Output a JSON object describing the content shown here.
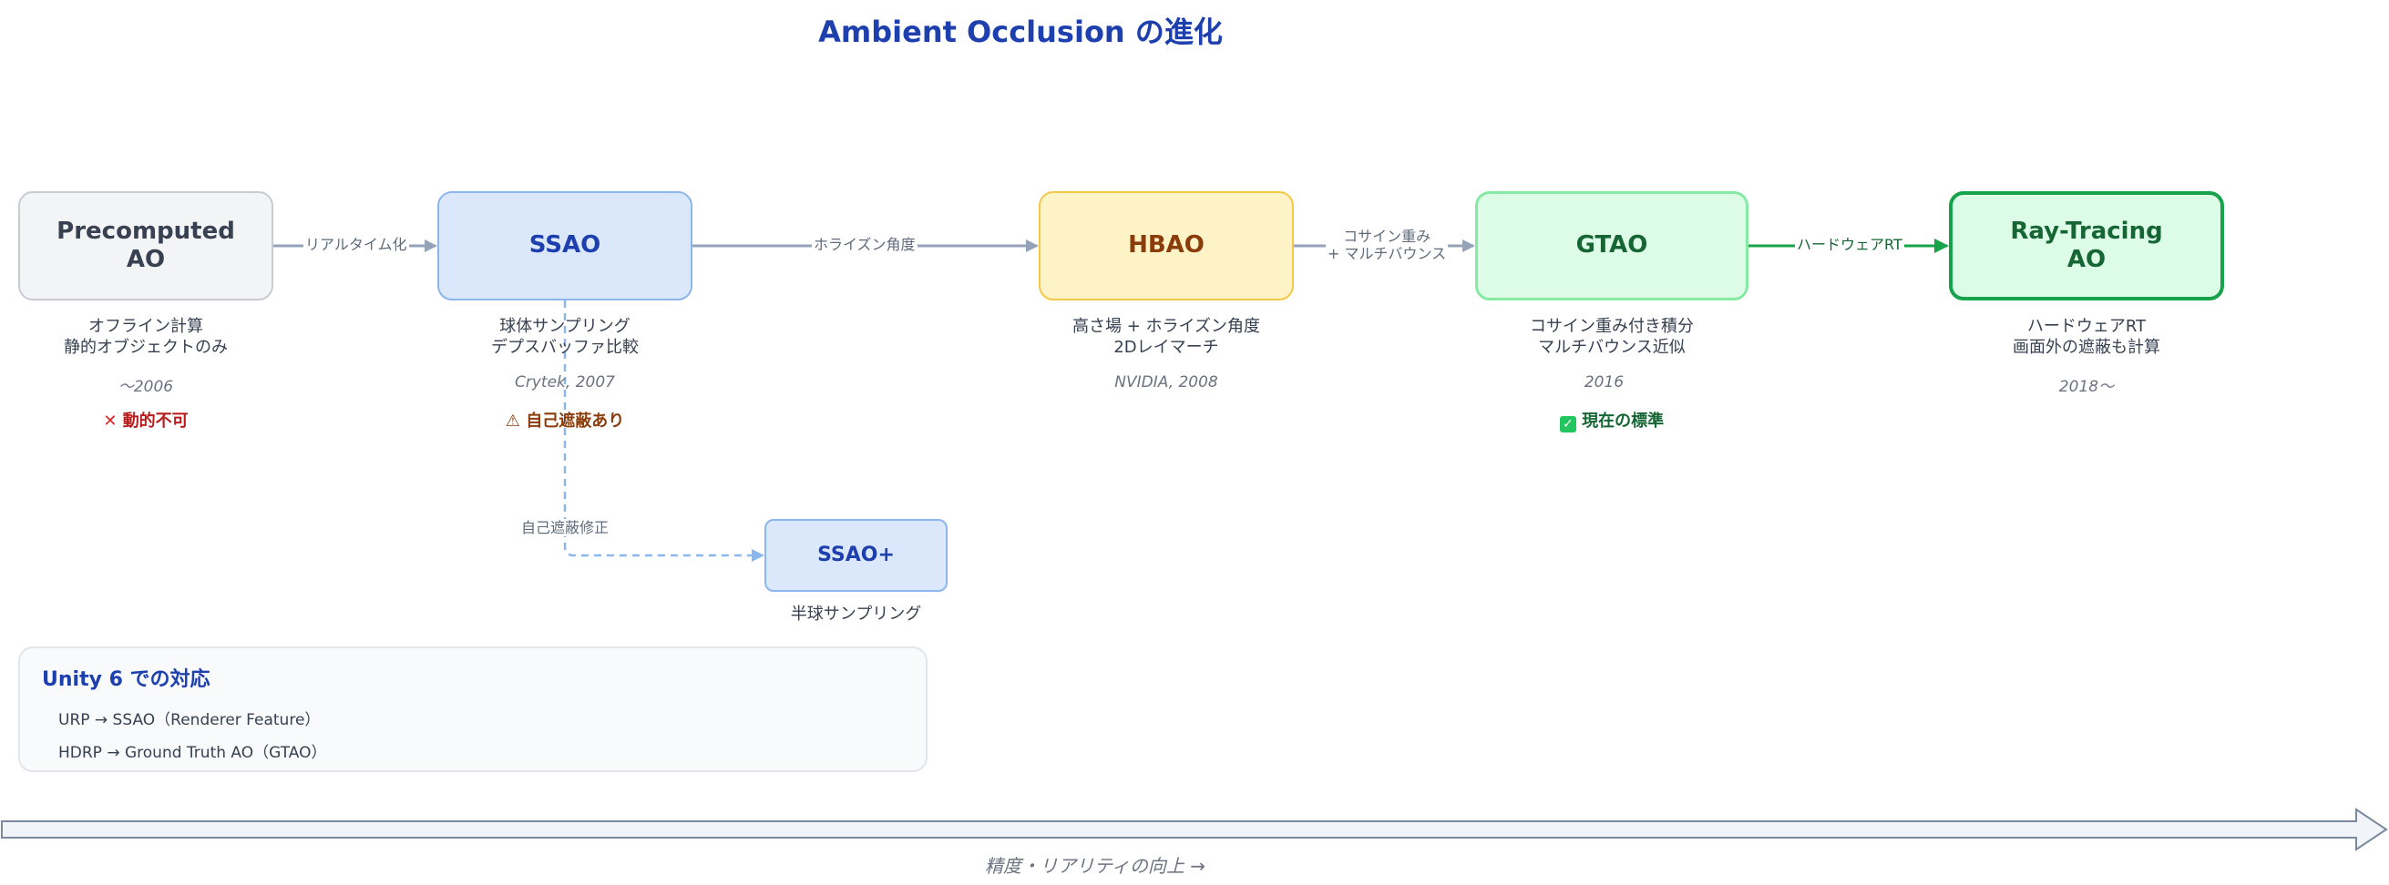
{
  "title": "Ambient Occlusion の進化",
  "colors": {
    "title": "#1e3fae",
    "edge_gray": "#94a3b8",
    "edge_green": "#16a34a",
    "edge_dashed": "#8cb6ee"
  },
  "nodes": {
    "precomputed": {
      "label": "Precomputed\nAO",
      "desc": "オフライン計算\n静的オブジェクトのみ",
      "year": "〜2006",
      "badge": "動的不可",
      "badge_icon": "cross-mark-icon"
    },
    "ssao": {
      "label": "SSAO",
      "desc": "球体サンプリング\nデプスバッファ比較",
      "year": "Crytek, 2007",
      "badge": "⚠ 自己遮蔽あり",
      "badge_icon": "warning-icon"
    },
    "hbao": {
      "label": "HBAO",
      "desc": "高さ場 + ホライズン角度\n2Dレイマーチ",
      "year": "NVIDIA, 2008"
    },
    "gtao": {
      "label": "GTAO",
      "desc": "コサイン重み付き積分\nマルチバウンス近似",
      "year": "2016",
      "badge": "現在の標準",
      "badge_icon": "check-mark-icon"
    },
    "raytracing": {
      "label": "Ray-Tracing\nAO",
      "desc": "ハードウェアRT\n画面外の遮蔽も計算",
      "year": "2018〜"
    },
    "ssao_plus": {
      "label": "SSAO+",
      "desc": "半球サンプリング"
    }
  },
  "edges": {
    "pre_to_ssao": "リアルタイム化",
    "ssao_to_hbao": "ホライズン角度",
    "hbao_to_gtao": "コサイン重み\n+ マルチバウンス",
    "gtao_to_rt": "ハードウェアRT",
    "ssao_to_ssaoplus": "自己遮蔽修正"
  },
  "panel": {
    "title": "Unity 6 での対応",
    "lines": [
      "URP → SSAO（Renderer Feature）",
      "HDRP → Ground Truth AO（GTAO）"
    ]
  },
  "axis": {
    "label": "精度・リアリティの向上 →"
  }
}
